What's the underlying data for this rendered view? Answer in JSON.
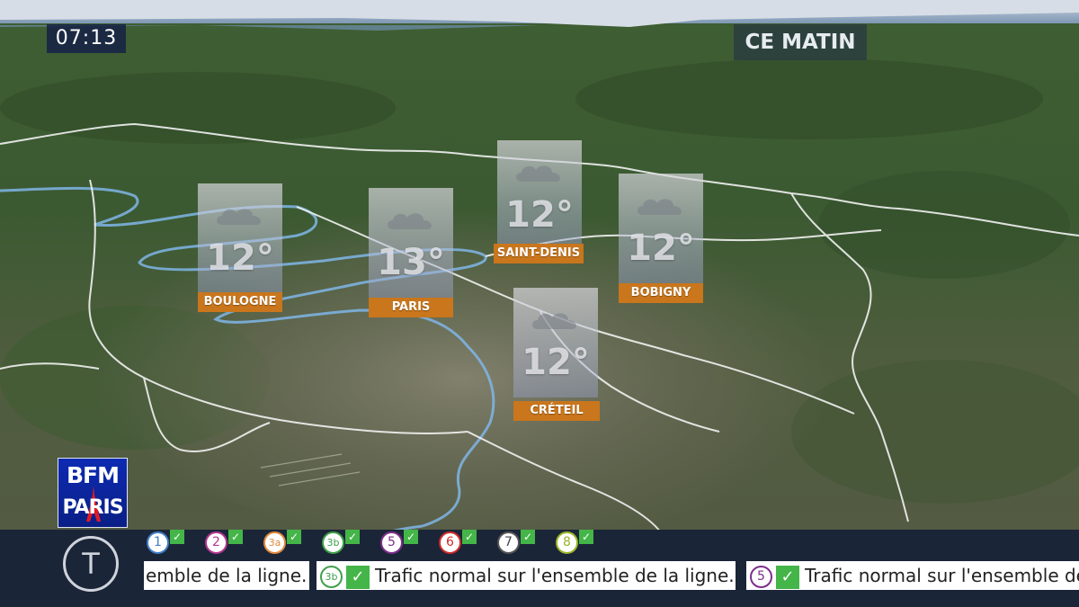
{
  "clock": {
    "time": "07:13"
  },
  "period_label": "CE MATIN",
  "forecast": [
    {
      "city": "BOULOGNE",
      "temp": "12°",
      "icon": "cloud-icon"
    },
    {
      "city": "PARIS",
      "temp": "13°",
      "icon": "cloud-icon"
    },
    {
      "city": "SAINT-DENIS",
      "temp": "12°",
      "icon": "cloud-icon"
    },
    {
      "city": "BOBIGNY",
      "temp": "12°",
      "icon": "cloud-icon"
    },
    {
      "city": "CRÉTEIL",
      "temp": "12°",
      "icon": "cloud-icon"
    }
  ],
  "logo": {
    "line1": "BFM",
    "line2": "PARIS"
  },
  "transport": {
    "mode_symbol": "T",
    "lines": [
      {
        "label": "1",
        "color": "#3f7dc8",
        "status_icon": "check-icon"
      },
      {
        "label": "2",
        "color": "#b2378f",
        "status_icon": "check-icon"
      },
      {
        "label": "3a",
        "color": "#e08a3c",
        "status_icon": "check-icon"
      },
      {
        "label": "3b",
        "color": "#3fa04a",
        "status_icon": "check-icon"
      },
      {
        "label": "5",
        "color": "#7c2f8a",
        "status_icon": "check-icon"
      },
      {
        "label": "6",
        "color": "#d12a2a",
        "status_icon": "check-icon"
      },
      {
        "label": "7",
        "color": "#555555",
        "status_icon": "check-icon"
      },
      {
        "label": "8",
        "color": "#9ab526",
        "status_icon": "check-icon"
      }
    ],
    "ticker": [
      {
        "line": "",
        "text": "emble de la ligne."
      },
      {
        "line": "3b",
        "line_color": "#3fa04a",
        "text": "Trafic normal sur l'ensemble de la ligne."
      },
      {
        "line": "5",
        "line_color": "#7c2f8a",
        "text": "Trafic normal sur l'ensemble de"
      }
    ]
  },
  "colors": {
    "river": "#7fb6e8",
    "border": "#f2f2f2",
    "city_label_bg": "#c9761c",
    "bfm_blue": "#0d2bb3",
    "ticker_bar": "#1b2538"
  }
}
